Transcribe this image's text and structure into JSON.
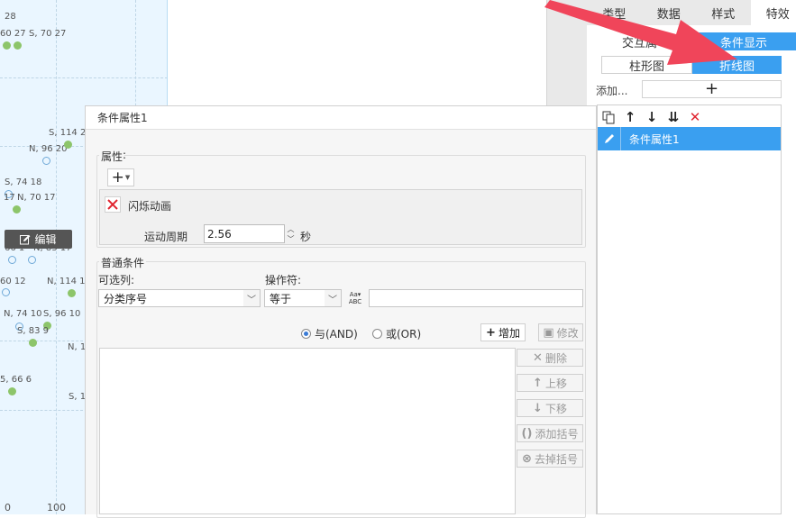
{
  "chart": {
    "point_labels": [
      "28",
      "60  27",
      "S, 70  27",
      "S, 114  2",
      "N, 96  20",
      "S, 74  18",
      "17",
      "N, 70  17",
      "66  1",
      "N, 83  17",
      "60  12",
      "N, 114  1",
      "N, 74  10",
      "S, 96  10",
      "S, 83  9",
      "N, 1",
      "5, 66  6",
      "S, 1"
    ],
    "axis_label": "100",
    "edit_button": "编辑"
  },
  "tabs": [
    "类型",
    "数据",
    "样式",
    "特效"
  ],
  "active_tab": "特效",
  "sub_tabs": [
    "交互属",
    "条件显示"
  ],
  "chart_types": [
    "柱形图",
    "折线图"
  ],
  "add_label": "添加...",
  "add_button": "+",
  "list_item": "条件属性1",
  "dialog": {
    "title": "条件属性1",
    "attributes": {
      "title": "属性",
      "effect_name": "闪烁动画",
      "period_label": "运动周期",
      "period_value": "2.56",
      "period_unit": "秒"
    },
    "conditions": {
      "title": "普通条件",
      "column_label": "可选列:",
      "column_value": "分类序号",
      "operator_label": "操作符:",
      "operator_value": "等于",
      "value": "",
      "and_label": "与(AND)",
      "or_label": "或(OR)",
      "logic_selected": "AND",
      "add_btn": "增加",
      "modify_btn": "修改",
      "delete_btn": "删除",
      "up_btn": "上移",
      "down_btn": "下移",
      "add_bracket_btn": "添加括号",
      "remove_bracket_btn": "去掉括号"
    }
  },
  "colors": {
    "accent": "#3a9ff0",
    "arrow": "#f0455a",
    "point_green": "#8dc56a",
    "point_blue": "#6fa9d8"
  }
}
